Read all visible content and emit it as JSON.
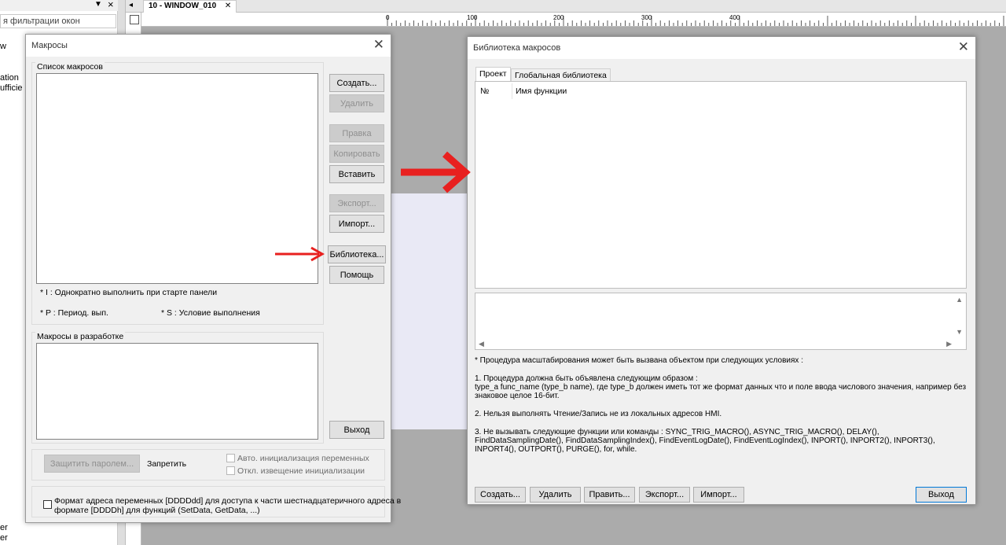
{
  "left_panel": {
    "filter_text": "я фильтрации окон",
    "tree_fragments": [
      "w",
      "ation",
      "ufficie",
      "er",
      "er"
    ]
  },
  "tabbar": {
    "tab_label": "10 - WINDOW_010",
    "tab_close": "✕"
  },
  "ruler": {
    "ticks": [
      "0",
      "100",
      "200",
      "300",
      "400"
    ]
  },
  "macros_dialog": {
    "title": "Макросы",
    "close": "✕",
    "list_group_title": "Список макросов",
    "buttons": {
      "create": "Создать...",
      "delete": "Удалить",
      "edit": "Правка",
      "copy": "Копировать",
      "paste": "Вставить",
      "export": "Экспорт...",
      "import": "Импорт...",
      "library": "Библиотека...",
      "help": "Помощь",
      "exit": "Выход",
      "password": "Защитить паролем..."
    },
    "legend": {
      "i": "* I : Однократно выполнить при старте панели",
      "p": "* P : Период. вып.",
      "s": "* S : Условие выполнения"
    },
    "dev_group_title": "Макросы в разработке",
    "forbid_label": "Запретить",
    "auto_init_label": "Авто. инициализация переменных",
    "disable_notify_label": "Откл. извещение инициализации",
    "format_line1": "Формат адреса переменных [DDDDdd] для доступа к части шестнадцатеричного адреса в",
    "format_line2": "формате [DDDDh] для функций (SetData, GetData, ...)"
  },
  "library_dialog": {
    "title": "Библиотека макросов",
    "close": "✕",
    "tabs": [
      "Проект",
      "Глобальная библиотека"
    ],
    "columns": [
      "№",
      "Имя функции"
    ],
    "desc": {
      "intro": "* Процедура масштабирования может быть вызвана объектом при следующих условиях :",
      "p1_a": "1. Процедура должна быть объявлена следующим образом :",
      "p1_b": "type_a func_name (type_b name), где type_b должен иметь тот же формат данных что и поле ввода числового значения, например без знаковое целое 16-бит.",
      "p2": "2. Нельзя выполнять Чтение/Запись не из локальных адресов HMI.",
      "p3": "3. Не вызывать следующие функции или команды : SYNC_TRIG_MACRO(), ASYNC_TRIG_MACRO(), DELAY(), FindDataSamplingDate(), FindDataSamplingIndex(), FindEventLogDate(), FindEventLogIndex(), INPORT(), INPORT2(), INPORT3(), INPORT4(), OUTPORT(), PURGE(), for, while."
    },
    "buttons": {
      "create": "Создать...",
      "delete": "Удалить",
      "edit": "Править...",
      "export": "Экспорт...",
      "import": "Импорт...",
      "exit": "Выход"
    }
  },
  "colors": {
    "arrow": "#e8201f",
    "focus": "#0078d7"
  }
}
